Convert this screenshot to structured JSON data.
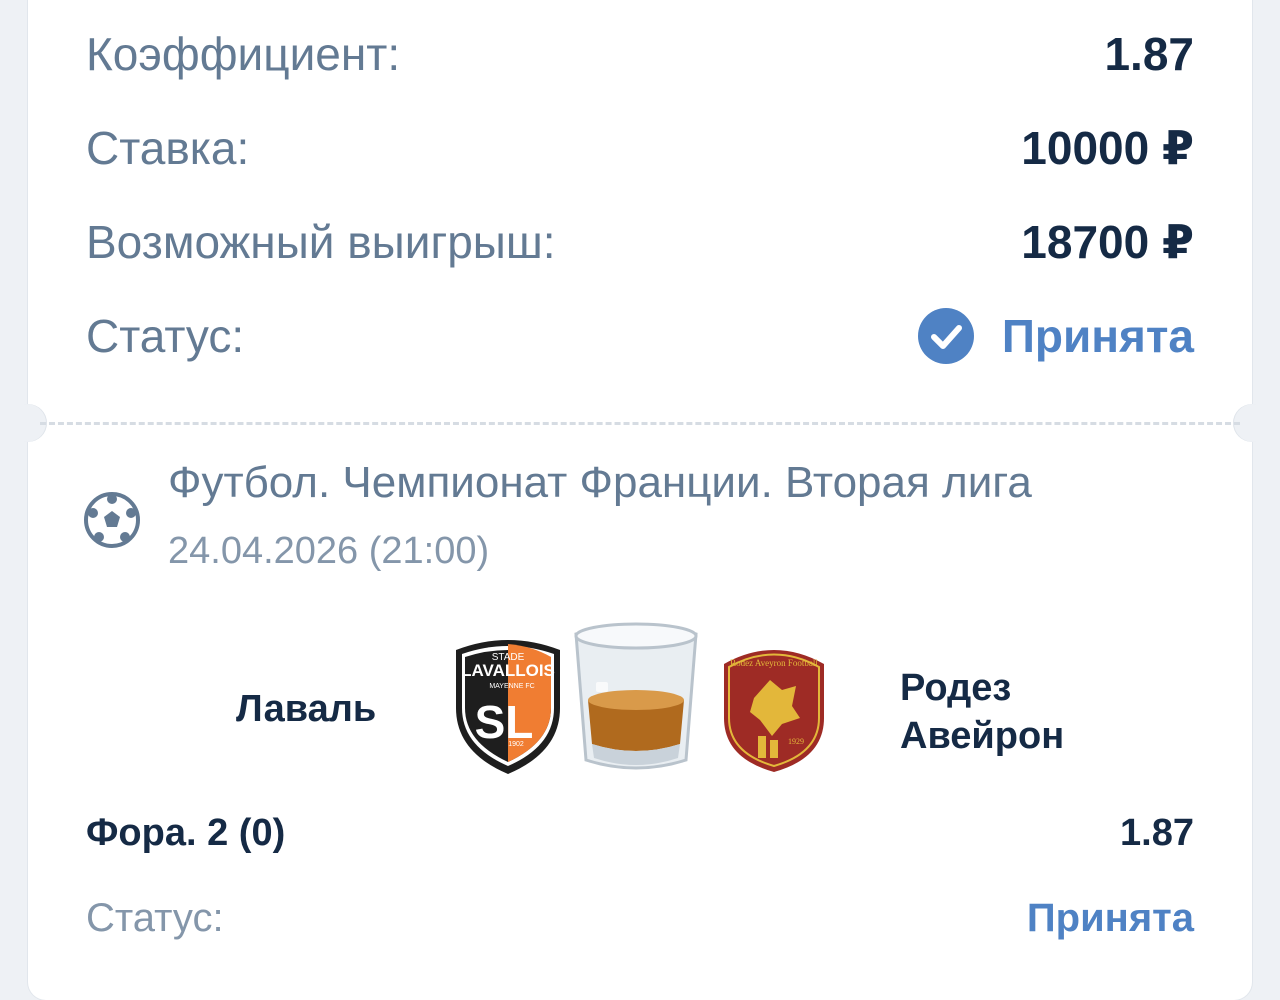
{
  "summary": {
    "odds_label": "Коэффициент:",
    "odds_value": "1.87",
    "stake_label": "Ставка:",
    "stake_value": "10000 ₽",
    "win_label": "Возможный выигрыш:",
    "win_value": "18700 ₽",
    "status_label": "Статус:",
    "status_value": "Принята"
  },
  "event": {
    "sport_icon": "soccer-ball-icon",
    "league": "Футбол. Чемпионат Франции. Вторая лига",
    "datetime": "24.04.2026 (21:00)",
    "home_team": "Лаваль",
    "away_team": "Родез Авейрон",
    "home_logo_text": "STADE LAVALLOIS MAYENNE FC SL 1902",
    "away_logo_text": "Rodez Aveyron Football 1929",
    "center_icon": "whiskey-glass-icon",
    "market": "Фора. 2 (0)",
    "market_odds": "1.87",
    "status_label": "Статус:",
    "status_value": "Принята"
  },
  "colors": {
    "accent": "#4f82c4",
    "label": "#637a93",
    "value": "#152a45",
    "background": "#eef1f5"
  }
}
